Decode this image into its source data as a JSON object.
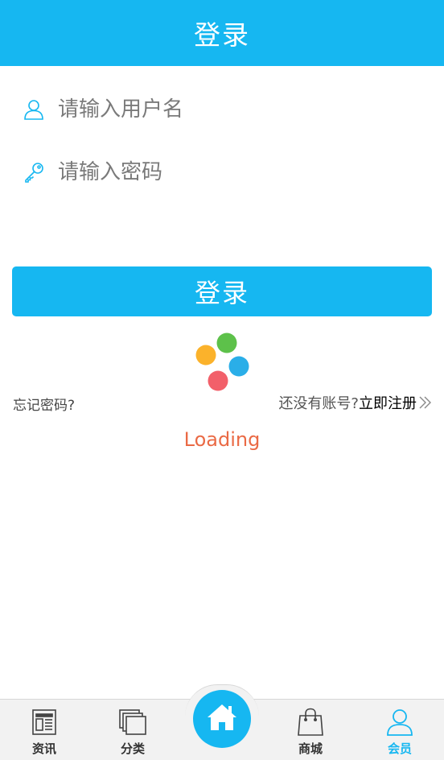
{
  "header": {
    "title": "登录"
  },
  "form": {
    "username": {
      "placeholder": "请输入用户名",
      "value": "",
      "icon": "user-icon"
    },
    "password": {
      "placeholder": "请输入密码",
      "value": "",
      "icon": "key-icon"
    },
    "submit_label": "登录"
  },
  "links": {
    "forgot_password": "忘记密码?",
    "no_account": "还没有账号?",
    "register": "立即注册"
  },
  "loading": {
    "text": "Loading"
  },
  "tabbar": {
    "items": [
      {
        "label": "资讯",
        "icon": "news-icon"
      },
      {
        "label": "分类",
        "icon": "category-icon"
      },
      {
        "label": "",
        "icon": "home-icon"
      },
      {
        "label": "商城",
        "icon": "shopping-bag-icon"
      },
      {
        "label": "会员",
        "icon": "member-icon",
        "active": true
      }
    ]
  },
  "colors": {
    "accent": "#16b7f1",
    "loading_text": "#ea6a45",
    "dot_orange": "#fbb22b",
    "dot_green": "#5dc14a",
    "dot_blue": "#2aaee8",
    "dot_red": "#f2606a"
  }
}
